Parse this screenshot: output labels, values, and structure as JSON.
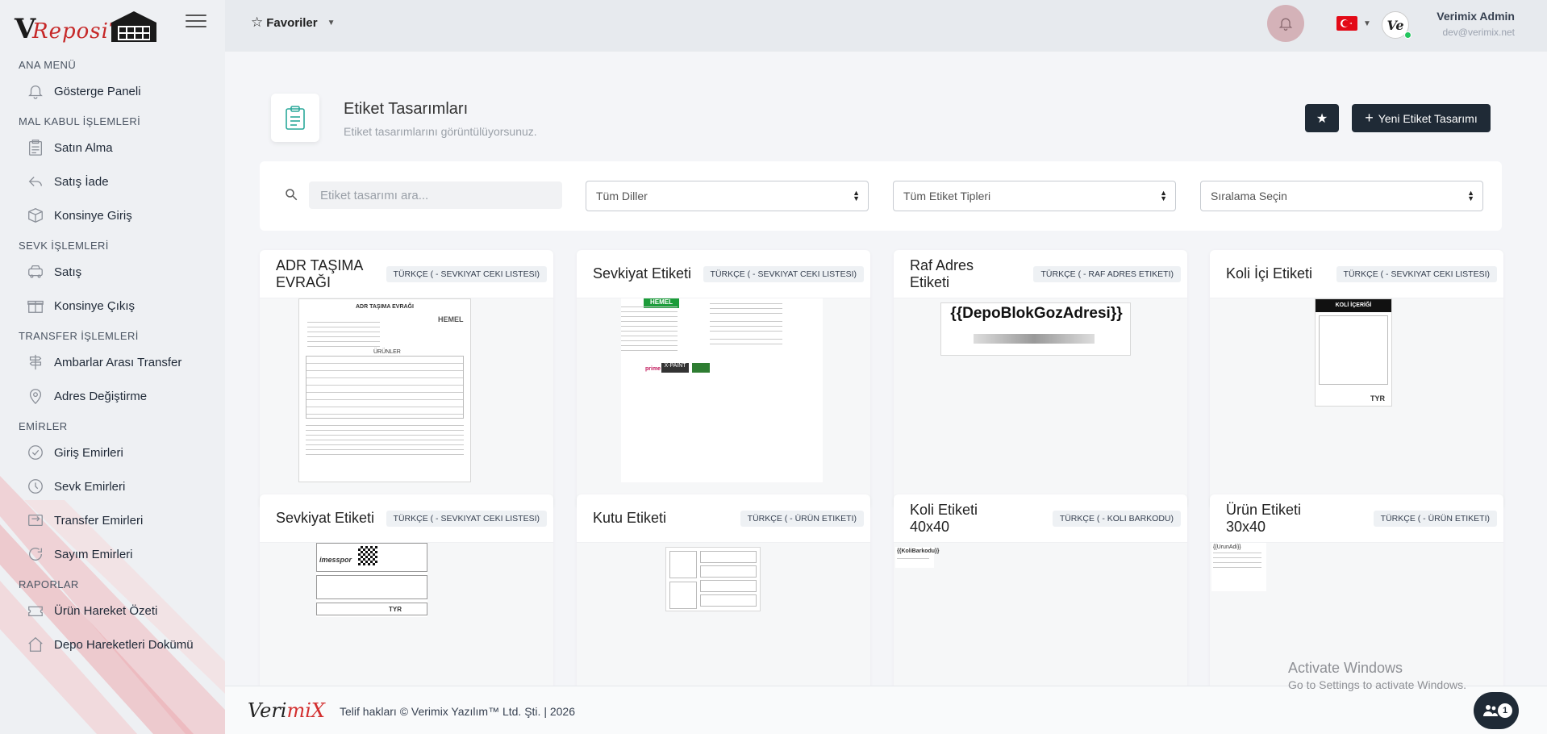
{
  "brand": {
    "text": "ReposiT"
  },
  "sidebar": {
    "sections": [
      {
        "title": "ANA MENÜ",
        "items": [
          {
            "label": "Gösterge Paneli",
            "icon": "bell-icon"
          }
        ]
      },
      {
        "title": "MAL KABUL İŞLEMLERİ",
        "items": [
          {
            "label": "Satın Alma",
            "icon": "clipboard-icon"
          },
          {
            "label": "Satış İade",
            "icon": "reply-icon"
          },
          {
            "label": "Konsinye Giriş",
            "icon": "box-icon"
          }
        ]
      },
      {
        "title": "SEVK İŞLEMLERİ",
        "items": [
          {
            "label": "Satış",
            "icon": "car-icon"
          },
          {
            "label": "Konsinye Çıkış",
            "icon": "gift-icon"
          }
        ]
      },
      {
        "title": "TRANSFER İŞLEMLERİ",
        "items": [
          {
            "label": "Ambarlar Arası Transfer",
            "icon": "signpost-icon"
          },
          {
            "label": "Adres Değiştirme",
            "icon": "map-pin-icon"
          }
        ]
      },
      {
        "title": "EMİRLER",
        "items": [
          {
            "label": "Giriş Emirleri",
            "icon": "check-circle-icon"
          },
          {
            "label": "Sevk Emirleri",
            "icon": "clock-icon"
          },
          {
            "label": "Transfer Emirleri",
            "icon": "transfer-icon"
          },
          {
            "label": "Sayım Emirleri",
            "icon": "refresh-icon"
          }
        ]
      },
      {
        "title": "RAPORLAR",
        "items": [
          {
            "label": "Ürün Hareket Özeti",
            "icon": "ticket-icon"
          },
          {
            "label": "Depo Hareketleri Dokümü",
            "icon": "home-icon"
          }
        ]
      }
    ]
  },
  "topbar": {
    "favorites_label": "Favoriler",
    "user_name": "Verimix Admin",
    "user_email": "dev@verimix.net",
    "avatar_text": "Ve"
  },
  "header": {
    "title": "Etiket Tasarımları",
    "subtitle": "Etiket tasarımlarını görüntülüyorsunuz.",
    "new_button_label": "Yeni Etiket Tasarımı"
  },
  "filters": {
    "search_placeholder": "Etiket tasarımı ara...",
    "language_select": "Tüm Diller",
    "type_select": "Tüm Etiket Tipleri",
    "sort_select": "Sıralama Seçin"
  },
  "cards": [
    {
      "title": "ADR TAŞIMA EVRAĞI",
      "badge": "TÜRKÇE ( - SEVKIYAT CEKI LISTESI)",
      "preview_text": [
        "ADR TAŞIMA EVRAĞI",
        "HEMEL",
        "ÜRÜNLER"
      ]
    },
    {
      "title": "Sevkiyat Etiketi",
      "badge": "TÜRKÇE ( - SEVKIYAT CEKI LISTESI)",
      "preview_text": [
        "HEMEL",
        "prime",
        "X-PAINT"
      ]
    },
    {
      "title": "Raf Adres Etiketi",
      "badge": "TÜRKÇE ( - RAF ADRES ETIKETI)",
      "preview_text": [
        "{{DepoBlokGozAdresi}}"
      ]
    },
    {
      "title": "Koli İçi Etiketi",
      "badge": "TÜRKÇE ( - SEVKIYAT CEKI LISTESI)",
      "preview_text": [
        "KOLİ İÇERİĞİ",
        "TYR"
      ]
    },
    {
      "title": "Sevkiyat Etiketi",
      "badge": "TÜRKÇE ( - SEVKIYAT CEKI LISTESI)",
      "preview_text": [
        "imesspor",
        "TYR"
      ]
    },
    {
      "title": "Kutu Etiketi",
      "badge": "TÜRKÇE ( - ÜRÜN ETIKETI)",
      "preview_text": []
    },
    {
      "title": "Koli Etiketi 40x40",
      "badge": "TÜRKÇE ( - KOLI BARKODU)",
      "preview_text": [
        "{{KoliBarkodu}}"
      ]
    },
    {
      "title": "Ürün Etiketi 30x40",
      "badge": "TÜRKÇE ( - ÜRÜN ETIKETI)",
      "preview_text": [
        "{{UrunAdi}}"
      ]
    }
  ],
  "footer": {
    "logo_main": "Veri",
    "logo_accent": "miX",
    "copyright": "Telif hakları © Verimix Yazılım™ Ltd. Şti. | 2026"
  },
  "overlay": {
    "activate_title": "Activate Windows",
    "activate_sub": "Go to Settings to activate Windows.",
    "chat_count": "1"
  },
  "colors": {
    "dark_button": "#1f2a36",
    "accent_red": "#d32f2f",
    "flag": "#e30a17",
    "online": "#22c55e"
  }
}
